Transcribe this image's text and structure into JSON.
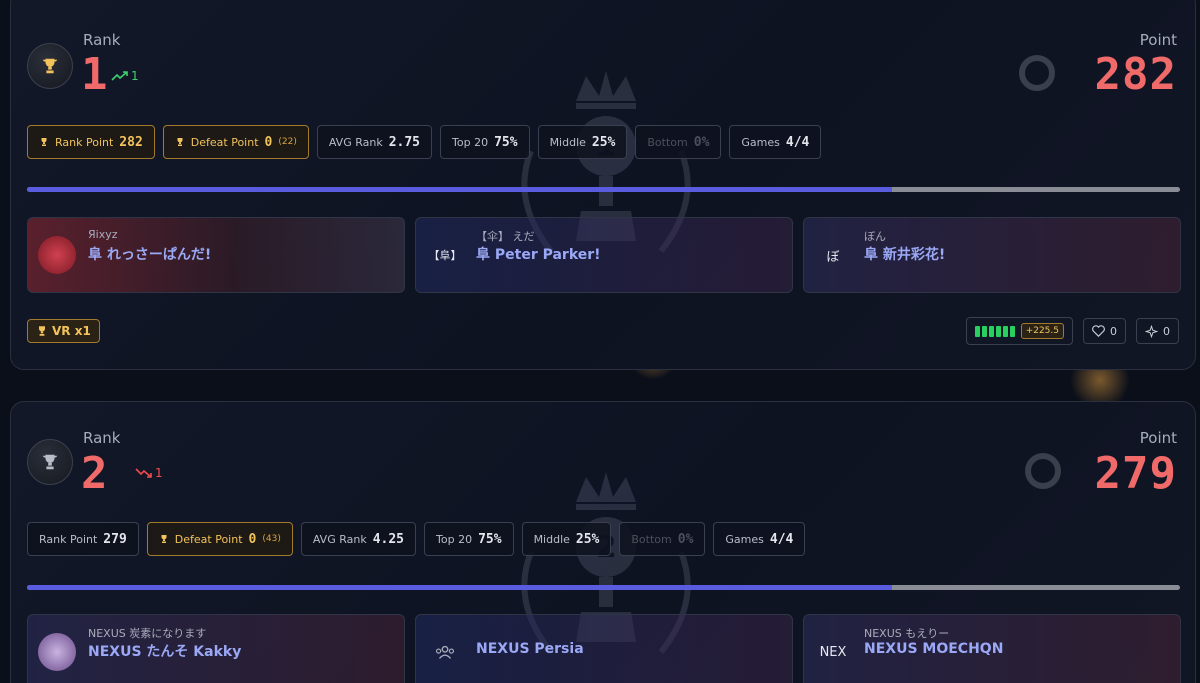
{
  "cards": [
    {
      "rank_label": "Rank",
      "rank": "1",
      "trend": "1",
      "trend_dir": "up",
      "point_label": "Point",
      "points": "282",
      "emblem_number": "1",
      "stats": [
        {
          "label": "Rank Point",
          "value": "282",
          "sub": "",
          "style": "gold"
        },
        {
          "label": "Defeat Point",
          "value": "0",
          "sub": "(22)",
          "style": "gold"
        },
        {
          "label": "AVG Rank",
          "value": "2.75",
          "sub": "",
          "style": ""
        },
        {
          "label": "Top 20",
          "value": "75%",
          "sub": "",
          "style": ""
        },
        {
          "label": "Middle",
          "value": "25%",
          "sub": "",
          "style": ""
        },
        {
          "label": "Bottom",
          "value": "0%",
          "sub": "",
          "style": "dim"
        },
        {
          "label": "Games",
          "value": "4/4",
          "sub": "",
          "style": ""
        }
      ],
      "progress": 0.75,
      "players": [
        {
          "sub": "Яixyz",
          "name": "阜 れっさーぱんだ!",
          "avatar": "",
          "theme": "red"
        },
        {
          "sub": "【伞】 えだ",
          "name": "阜 Peter Parker!",
          "avatar": "【阜】",
          "theme": "blue"
        },
        {
          "sub": "ぼん",
          "name": "阜 新井彩花!",
          "avatar": "ぼ",
          "theme": "purple"
        }
      ],
      "vr_badge": "VR x1",
      "meter_value": "+225.5",
      "like_count": "0",
      "spark_count": "0"
    },
    {
      "rank_label": "Rank",
      "rank": "2",
      "trend": "1",
      "trend_dir": "down",
      "point_label": "Point",
      "points": "279",
      "emblem_number": "2",
      "stats": [
        {
          "label": "Rank Point",
          "value": "279",
          "sub": "",
          "style": ""
        },
        {
          "label": "Defeat Point",
          "value": "0",
          "sub": "(43)",
          "style": "gold"
        },
        {
          "label": "AVG Rank",
          "value": "4.25",
          "sub": "",
          "style": ""
        },
        {
          "label": "Top 20",
          "value": "75%",
          "sub": "",
          "style": ""
        },
        {
          "label": "Middle",
          "value": "25%",
          "sub": "",
          "style": ""
        },
        {
          "label": "Bottom",
          "value": "0%",
          "sub": "",
          "style": "dim"
        },
        {
          "label": "Games",
          "value": "4/4",
          "sub": "",
          "style": ""
        }
      ],
      "progress": 0.75,
      "players": [
        {
          "sub": "NEXUS 炭素になります",
          "name": "NEXUS たんそ Kakky",
          "avatar": "",
          "theme": "purple"
        },
        {
          "sub": "",
          "name": "NEXUS Persia",
          "avatar": "",
          "theme": "blue"
        },
        {
          "sub": "NEXUS もえりー",
          "name": "NEXUS MOECHQN",
          "avatar": "NEX",
          "theme": "purple"
        }
      ]
    }
  ],
  "colors": {
    "accent_red": "#f06a6a",
    "gold": "#f2c25c",
    "progress": "#5a5ce0",
    "trend_up": "#3ecf6e",
    "trend_down": "#ef4b4b"
  }
}
